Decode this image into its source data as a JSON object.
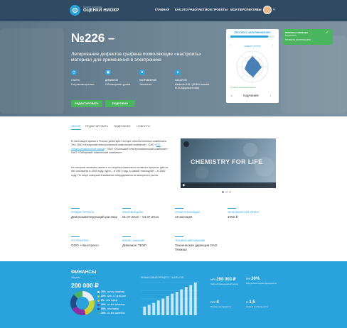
{
  "header": {
    "logo_sub": "Проект системы",
    "logo_title": "ОЦЕНКИ НИОКР",
    "nav": [
      "ГЛАВНАЯ",
      "КАК ЭТО РАБОТАЕТ",
      "МОИ ПРОЕКТЫ",
      "МОИ ПЕРСПЕКТИВЫ"
    ]
  },
  "hero": {
    "title": "№226 –",
    "description": "Легирование дефектов графена позволяющие «настроить» материал для применения в электронике",
    "facts": [
      {
        "label": "СТАТУС",
        "value": "На рассмотрении",
        "icon": "clock-icon"
      },
      {
        "label": "ДИВИЗИОН",
        "value": "Обогащение урана",
        "icon": "building-icon"
      },
      {
        "label": "НАПРАВЛЕНИЕ",
        "value": "Экология",
        "icon": "leaf-icon"
      },
      {
        "label": "ЗАКАЗЧИК",
        "value": "Иванов В.В. (ЗКБМ имени И.И.Африкантова)",
        "icon": "user-icon"
      }
    ],
    "edit_button": "РЕДАКТИРОВАТЬ",
    "details_button": "ПОДРОБНО"
  },
  "progress_card": {
    "title": "ПРОГРЕСС ЗАПОЛНЕНИЯ 85%",
    "progress": 0.85,
    "subtitle": "ЖИВАЯ ГРУППА",
    "note": "5 шагов последовательно",
    "action": "ПОДРОБНЕЕ"
  },
  "notification": {
    "line1": "ПРОГРЕСС ИЗМЕНЕН",
    "line2": "Разрешено",
    "line3": "ПРОЕКТЕ ЗАПОЛНЕНИЯ"
  },
  "tabs": [
    "ОБЗОР",
    "РЕДАКТИРОВАТЬ",
    "ПОДРОБНЕЕ",
    "НОВОСТИ"
  ],
  "overview": {
    "para1_a": "В настоящее время в России действуют четыре обогатительных комбината. Это ОАО «Ангарский электролизный химический комбинат», ОАО «",
    "para1_link": "ПО Электрохимический завод",
    "para1_b": "», ОАО «Уральский электрохимический комбинат», ОАО «Сибирский химический комбинат».",
    "para2": "Их история началась вместе со стартом советского атомного проекта: два из них основаны в 1949 году, один – в 1957 году, а самый «молодой» – в 1962 году. По мере совершенствования оборудования их мощности росли."
  },
  "video": {
    "title": "CHEMISTRY FOR LIFE"
  },
  "info": [
    {
      "label": "ПРЕДМЕТ ПРОЕКТА",
      "value": "Деиольмамчерующий раствор"
    },
    {
      "label": "КЛЮЧЕВЫЕ ДАТЫ",
      "value": "01.07.2014 – 04.07.2014"
    },
    {
      "label": "СРОКИ РЕАЛИЗАЦИИ",
      "value": "18 месяцев"
    },
    {
      "label": "ЭКОНОМИЧЕСКИЙ ЭФФЕКТ",
      "value": "4000 ₽"
    },
    {
      "label": "ПОТРЕБИТЕЛИ",
      "value": "ООО «Нанотрекс»"
    },
    {
      "label": "БИЗНЕС-ЗАКАЗЧИК",
      "value": "Дивизион ТВЭЛ"
    },
    {
      "label": "ТЕХНИЧЕСКИЙ ЗАКАЗЧИК",
      "value": "Техническая дирекция ОАО Техмаш"
    }
  ],
  "finances": {
    "title": "ФИНАНСЫ",
    "sublabel": "Затраты",
    "amount": "200 000 ₽",
    "colors": {
      "accent": "#2aa2dc",
      "green": "#4bb45f"
    },
    "legend": [
      {
        "pct": "25%",
        "label": "survey roadmap",
        "color": "#e8edf1"
      },
      {
        "pct": "25%",
        "label": "spec 17 grad pub",
        "color": "#c7d33a"
      },
      {
        "pct": "5%",
        "label": "new laptop",
        "color": "#f2c21a"
      },
      {
        "pct": "25%",
        "label": "on-line advertise",
        "color": "#8c2fa6"
      },
      {
        "pct": "25%",
        "label": "new laptop",
        "color": "#234d8a"
      },
      {
        "pct": "15%",
        "label": "on-line advertise",
        "color": "#4bb45f"
      }
    ],
    "bar_title": "ФИНАНСОВЫЙ ПРОЦЕСС, ТЫСЯЧ РУБ",
    "bars": [
      14,
      17,
      20,
      24,
      27,
      31,
      35,
      38,
      42,
      46,
      49,
      53
    ],
    "kpis": [
      {
        "prefix": "NPV",
        "value": "200 000 ₽",
        "label": "Чистый приведенный доход"
      },
      {
        "prefix": "IRR",
        "value": "30%",
        "label": "Внутренняя норма доходности"
      },
      {
        "prefix": "DPP",
        "value": "4",
        "label": "Период окупаемости"
      },
      {
        "prefix": "PI",
        "value": "1,5",
        "label": "Индекс прибыльности"
      }
    ]
  }
}
